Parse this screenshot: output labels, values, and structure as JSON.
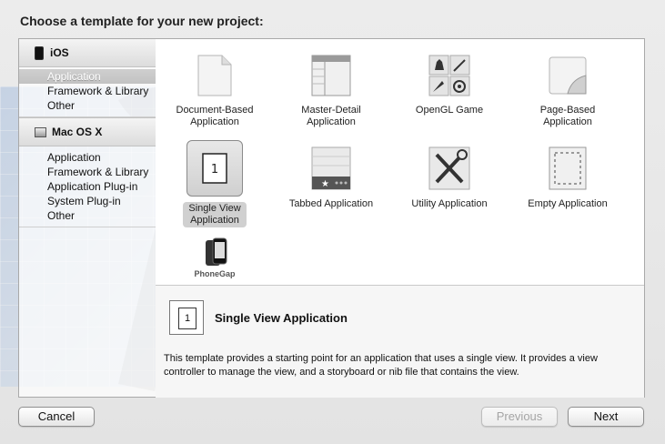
{
  "dialog": {
    "title": "Choose a template for your new project:"
  },
  "sidebar": {
    "sections": [
      {
        "header": "iOS",
        "icon": "iphone-icon",
        "items": [
          "Application",
          "Framework & Library",
          "Other"
        ],
        "selected": "Application"
      },
      {
        "header": "Mac OS X",
        "icon": "mac-icon",
        "items": [
          "Application",
          "Framework & Library",
          "Application Plug-in",
          "System Plug-in",
          "Other"
        ]
      }
    ]
  },
  "templates": [
    {
      "label": "Document-Based Application",
      "icon": "document-icon"
    },
    {
      "label": "Master-Detail Application",
      "icon": "master-detail-icon"
    },
    {
      "label": "OpenGL Game",
      "icon": "opengl-game-icon"
    },
    {
      "label": "Page-Based Application",
      "icon": "page-curl-icon"
    },
    {
      "label": "Single View Application",
      "icon": "single-view-icon",
      "selected": true
    },
    {
      "label": "Tabbed Application",
      "icon": "tabbed-icon"
    },
    {
      "label": "Utility Application",
      "icon": "utility-tools-icon"
    },
    {
      "label": "Empty Application",
      "icon": "empty-app-icon"
    },
    {
      "label": "PhoneGap",
      "icon": "phonegap-icon"
    }
  ],
  "description": {
    "icon_text": "1",
    "title": "Single View Application",
    "text": "This template provides a starting point for an application that uses a single view. It provides a view controller to manage the view, and a storyboard or nib file that contains the view."
  },
  "buttons": {
    "cancel": "Cancel",
    "previous": "Previous",
    "next": "Next"
  },
  "colors": {
    "selection_gray": "#cfcfcf",
    "blueprint_blue": "#a9c0df"
  }
}
